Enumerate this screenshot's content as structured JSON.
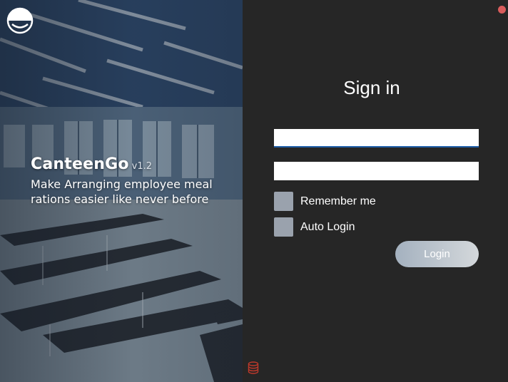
{
  "branding": {
    "app_name": "CanteenGo",
    "version": "v1.2",
    "tagline": "Make Arranging employee meal rations easier like never before",
    "logo_icon": "canteengo-logo-icon",
    "background_image": "canteen-hall-illustration"
  },
  "signin": {
    "title": "Sign in",
    "username_value": "",
    "password_value": "",
    "remember_me_label": "Remember me",
    "remember_me_checked": false,
    "auto_login_label": "Auto Login",
    "auto_login_checked": false,
    "login_button_label": "Login"
  },
  "window": {
    "close_icon": "close-dot-icon",
    "close_color": "#d95c5c"
  },
  "footer": {
    "database_icon": "database-icon",
    "database_icon_color": "#c0392b"
  },
  "colors": {
    "panel_background": "#262626",
    "input_focus_underline": "#1f5fa8",
    "checkbox_fill": "#9aa2ad",
    "button_gradient_start": "#a4b1bf",
    "button_gradient_end": "#d4d8db"
  }
}
